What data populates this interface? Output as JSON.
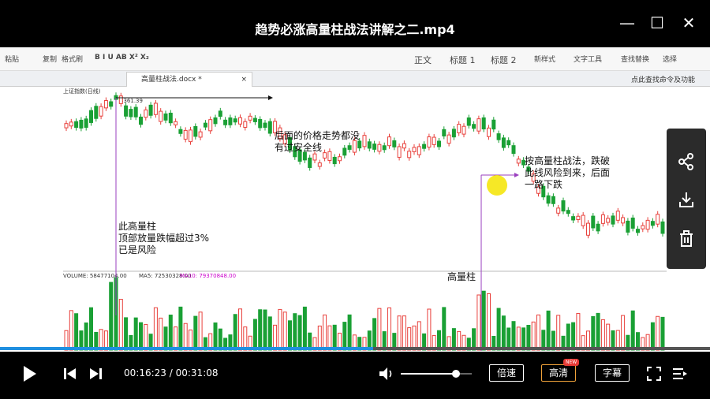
{
  "window": {
    "title": "趋势必涨高量柱战法讲解之二.mp4",
    "minimize": "—",
    "maximize": "☐",
    "close": "✕"
  },
  "ribbon": {
    "paste": "粘贴",
    "copy": "复制",
    "format_painter": "格式刷",
    "style_normal": "正文",
    "style_h1": "标题 1",
    "style_h2": "标题 2",
    "new_style": "新样式",
    "text_tools": "文字工具",
    "find_replace": "查找替换",
    "select": "选择"
  },
  "doc_tab": {
    "label": "高量柱战法.docx *",
    "command_search": "点此查找命令及功能"
  },
  "chart_text": {
    "index_name": "上证指数(日线)",
    "peak_value": "3361.39",
    "volume_label": "VOLUME: 58477104.00",
    "ma5_label": "MA5: 72530328.00",
    "ma10_label": "MA10: 79370848.00"
  },
  "annotations": {
    "a1_line1": "后面的价格走势都没",
    "a1_line2": "有过安全线",
    "a2_line1": "此高量柱",
    "a2_line2": "顶部放量跌幅超过3%",
    "a2_line3": "已是风险",
    "a3_line1": "按高量柱战法，跌破",
    "a3_line2": "此线风险到来，后面",
    "a3_line3": "一路下跌",
    "a4": "高量柱"
  },
  "player": {
    "current_time": "00:16:23",
    "total_time": "00:31:08",
    "separator": "/",
    "speed": "倍速",
    "quality": "高清",
    "quality_badge": "NEW",
    "subtitle": "字幕",
    "progress_fraction": 0.526,
    "volume_fraction": 0.78
  },
  "side_actions": [
    {
      "icon": "share-icon"
    },
    {
      "icon": "download-icon"
    },
    {
      "icon": "trash-icon"
    }
  ],
  "colors": {
    "up": "#e8413c",
    "down": "#1aa035",
    "accent": "#1f8fe0"
  }
}
